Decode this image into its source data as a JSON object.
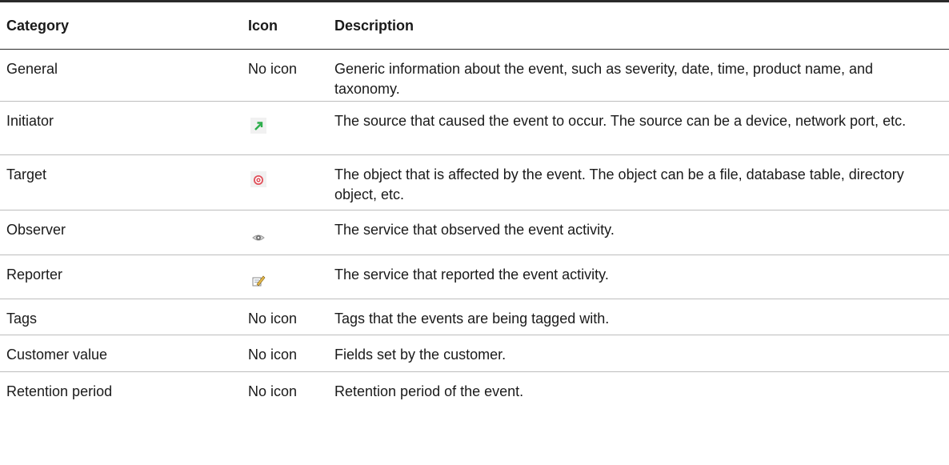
{
  "table": {
    "headers": [
      "Category",
      "Icon",
      "Description"
    ],
    "rows": [
      {
        "category": "General",
        "icon_text": "No icon",
        "description": "Generic information about the event, such as severity, date, time, product name, and taxonomy."
      },
      {
        "category": "Initiator",
        "icon": "green-arrow-icon",
        "description": "The source that caused the event to occur. The source can be a device, network port, etc."
      },
      {
        "category": "Target",
        "icon": "target-bullseye-icon",
        "description": "The object that is affected by the event. The object can be a file, database table, directory object, etc."
      },
      {
        "category": "Observer",
        "icon": "eye-icon",
        "description": "The service that observed the event activity."
      },
      {
        "category": "Reporter",
        "icon": "edit-report-icon",
        "description": "The service that reported the event activity."
      },
      {
        "category": "Tags",
        "icon_text": "No icon",
        "description": "Tags that the events are being tagged with."
      },
      {
        "category": "Customer value",
        "icon_text": "No icon",
        "description": "Fields set by the customer."
      },
      {
        "category": "Retention period",
        "icon_text": "No icon",
        "description": "Retention period of the event."
      }
    ]
  },
  "colors": {
    "rule_dark": "#2a2a2a",
    "rule_light": "#bdbdbd",
    "initiator_arrow": "#2eae4c",
    "target_red": "#e0505a"
  }
}
